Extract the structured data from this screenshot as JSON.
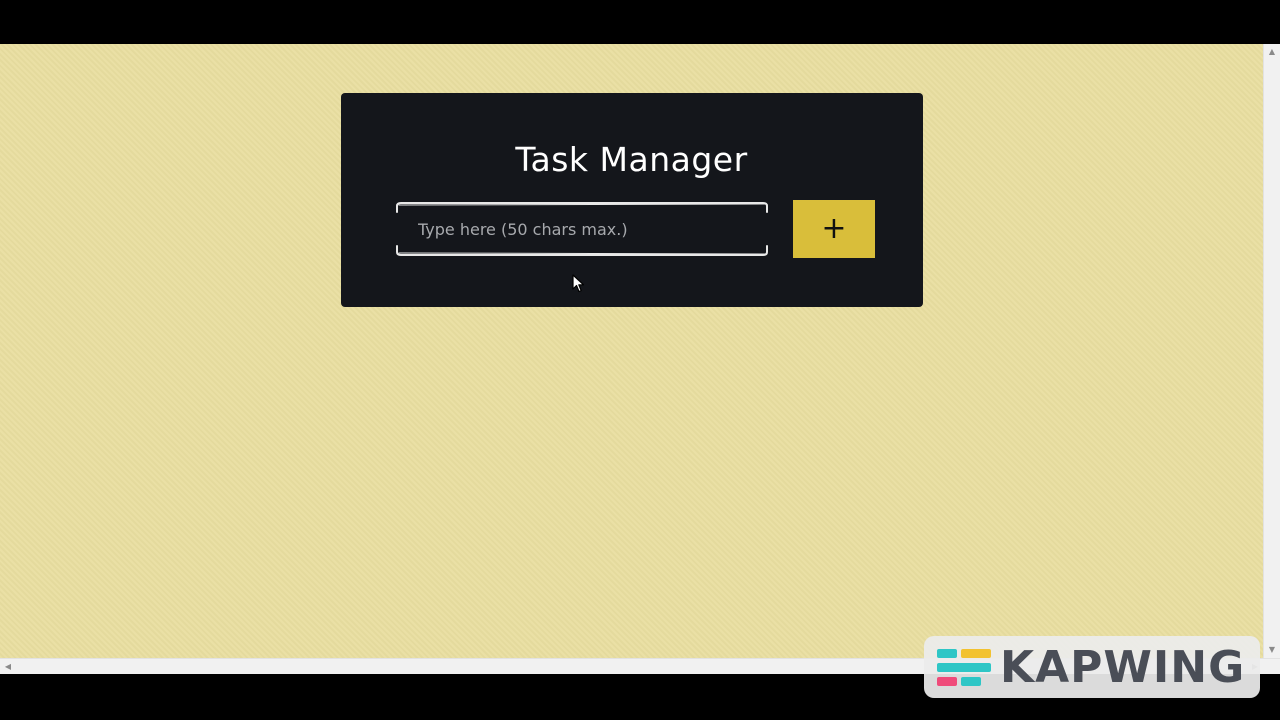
{
  "app": {
    "title": "Task Manager"
  },
  "task_form": {
    "input_value": "",
    "input_placeholder": "Type here (50 chars max.)",
    "add_button_label": "+"
  },
  "watermark": {
    "text": "KAPWING"
  },
  "colors": {
    "page_background": "#e9dea0",
    "card_background": "#14161b",
    "title_text": "#ffffff",
    "placeholder_text": "#a7a9ad",
    "add_button": "#d9be3a",
    "letterbox": "#000000",
    "watermark_text": "#4a4e57",
    "watermark_yellow": "#f2c230",
    "watermark_teal": "#2ec6c6",
    "watermark_pink": "#ef4b7a"
  },
  "icons": {
    "cursor": "mouse-pointer-icon",
    "scroll_up": "chevron-up-icon",
    "scroll_down": "chevron-down-icon",
    "scroll_left": "chevron-left-icon",
    "scroll_right": "chevron-right-icon"
  }
}
